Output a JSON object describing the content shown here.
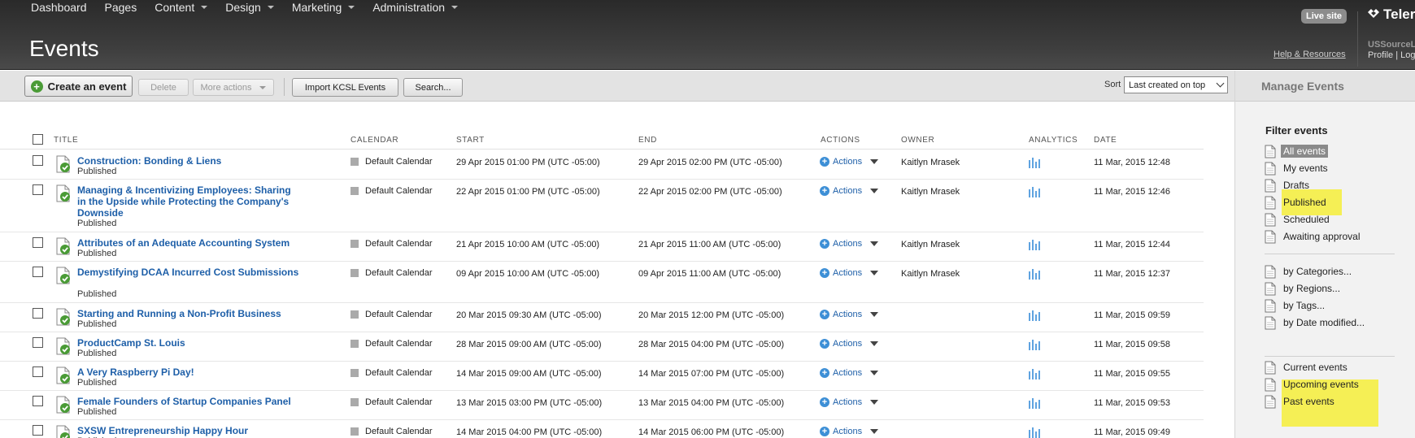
{
  "nav": {
    "items": [
      {
        "label": "Dashboard",
        "has_menu": false
      },
      {
        "label": "Pages",
        "has_menu": false
      },
      {
        "label": "Content",
        "has_menu": true
      },
      {
        "label": "Design",
        "has_menu": true
      },
      {
        "label": "Marketing",
        "has_menu": true
      },
      {
        "label": "Administration",
        "has_menu": true
      }
    ]
  },
  "header": {
    "page_title": "Events",
    "live_site_label": "Live site",
    "brand": "Teler",
    "help_link": "Help & Resources",
    "user_name": "USSourceL",
    "profile_link": "Profile",
    "logout_link": "Logo"
  },
  "toolbar": {
    "create_label": "Create an event",
    "delete_label": "Delete",
    "more_actions_label": "More actions",
    "import_label": "Import KCSL Events",
    "search_label": "Search...",
    "sort_label": "Sort",
    "sort_value": "Last created on top"
  },
  "table": {
    "headers": {
      "title": "TITLE",
      "calendar": "CALENDAR",
      "start": "START",
      "end": "END",
      "actions": "ACTIONS",
      "owner": "OWNER",
      "analytics": "ANALYTICS",
      "date": "DATE"
    },
    "actions_label": "Actions",
    "rows": [
      {
        "title": "Construction: Bonding & Liens",
        "status": "Published",
        "calendar": "Default Calendar",
        "start": "29 Apr 2015 01:00 PM (UTC -05:00)",
        "end": "29 Apr 2015 02:00 PM (UTC -05:00)",
        "owner": "Kaitlyn Mrasek",
        "date": "11 Mar, 2015 12:48"
      },
      {
        "title": "Managing & Incentivizing Employees: Sharing in the Upside while Protecting the Company's Downside",
        "status": "Published",
        "calendar": "Default Calendar",
        "start": "22 Apr 2015 01:00 PM (UTC -05:00)",
        "end": "22 Apr 2015 02:00 PM (UTC -05:00)",
        "owner": "Kaitlyn Mrasek",
        "date": "11 Mar, 2015 12:46"
      },
      {
        "title": "Attributes of an Adequate Accounting System",
        "status": "Published",
        "calendar": "Default Calendar",
        "start": "21 Apr 2015 10:00 AM (UTC -05:00)",
        "end": "21 Apr 2015 11:00 AM (UTC -05:00)",
        "owner": "Kaitlyn Mrasek",
        "date": "11 Mar, 2015 12:44"
      },
      {
        "title": "Demystifying DCAA Incurred Cost Submissions",
        "status": "Published",
        "calendar": "Default Calendar",
        "start": "09 Apr 2015 10:00 AM (UTC -05:00)",
        "end": "09 Apr 2015 11:00 AM (UTC -05:00)",
        "owner": "Kaitlyn Mrasek",
        "date": "11 Mar, 2015 12:37"
      },
      {
        "title": "Starting and Running a Non-Profit Business",
        "status": "Published",
        "calendar": "Default Calendar",
        "start": "20 Mar 2015 09:30 AM (UTC -05:00)",
        "end": "20 Mar 2015 12:00 PM (UTC -05:00)",
        "owner": "",
        "date": "11 Mar, 2015 09:59"
      },
      {
        "title": "ProductCamp St. Louis",
        "status": "Published",
        "calendar": "Default Calendar",
        "start": "28 Mar 2015 09:00 AM (UTC -05:00)",
        "end": "28 Mar 2015 04:00 PM (UTC -05:00)",
        "owner": "",
        "date": "11 Mar, 2015 09:58"
      },
      {
        "title": "A Very Raspberry Pi Day!",
        "status": "Published",
        "calendar": "Default Calendar",
        "start": "14 Mar 2015 09:00 AM (UTC -05:00)",
        "end": "14 Mar 2015 07:00 PM (UTC -05:00)",
        "owner": "",
        "date": "11 Mar, 2015 09:55"
      },
      {
        "title": "Female Founders of Startup Companies Panel",
        "status": "Published",
        "calendar": "Default Calendar",
        "start": "13 Mar 2015 03:00 PM (UTC -05:00)",
        "end": "13 Mar 2015 04:00 PM (UTC -05:00)",
        "owner": "",
        "date": "11 Mar, 2015 09:53"
      },
      {
        "title": "SXSW Entrepreneurship Happy Hour",
        "status": "Published",
        "calendar": "Default Calendar",
        "start": "14 Mar 2015 04:00 PM (UTC -05:00)",
        "end": "14 Mar 2015 06:00 PM (UTC -05:00)",
        "owner": "",
        "date": "11 Mar, 2015 09:49"
      }
    ]
  },
  "sidebar": {
    "title": "Manage Events",
    "filter_heading": "Filter events",
    "filters": [
      {
        "label": "All events",
        "selected": true,
        "highlighted": false
      },
      {
        "label": "My events",
        "selected": false,
        "highlighted": false
      },
      {
        "label": "Drafts",
        "selected": false,
        "highlighted": false
      },
      {
        "label": "Published",
        "selected": false,
        "highlighted": true
      },
      {
        "label": "Scheduled",
        "selected": false,
        "highlighted": false
      },
      {
        "label": "Awaiting approval",
        "selected": false,
        "highlighted": false
      }
    ],
    "by_filters": [
      "by Categories...",
      "by Regions...",
      "by Tags...",
      "by Date modified..."
    ],
    "time_filters": [
      {
        "label": "Current events",
        "highlighted": false
      },
      {
        "label": "Upcoming events",
        "highlighted": true
      },
      {
        "label": "Past events",
        "highlighted": true
      }
    ]
  },
  "colors": {
    "link": "#1e5fa8",
    "published_check": "#4a9b36",
    "highlight": "#f6ee3a",
    "analytics": "#5fa3e0"
  }
}
